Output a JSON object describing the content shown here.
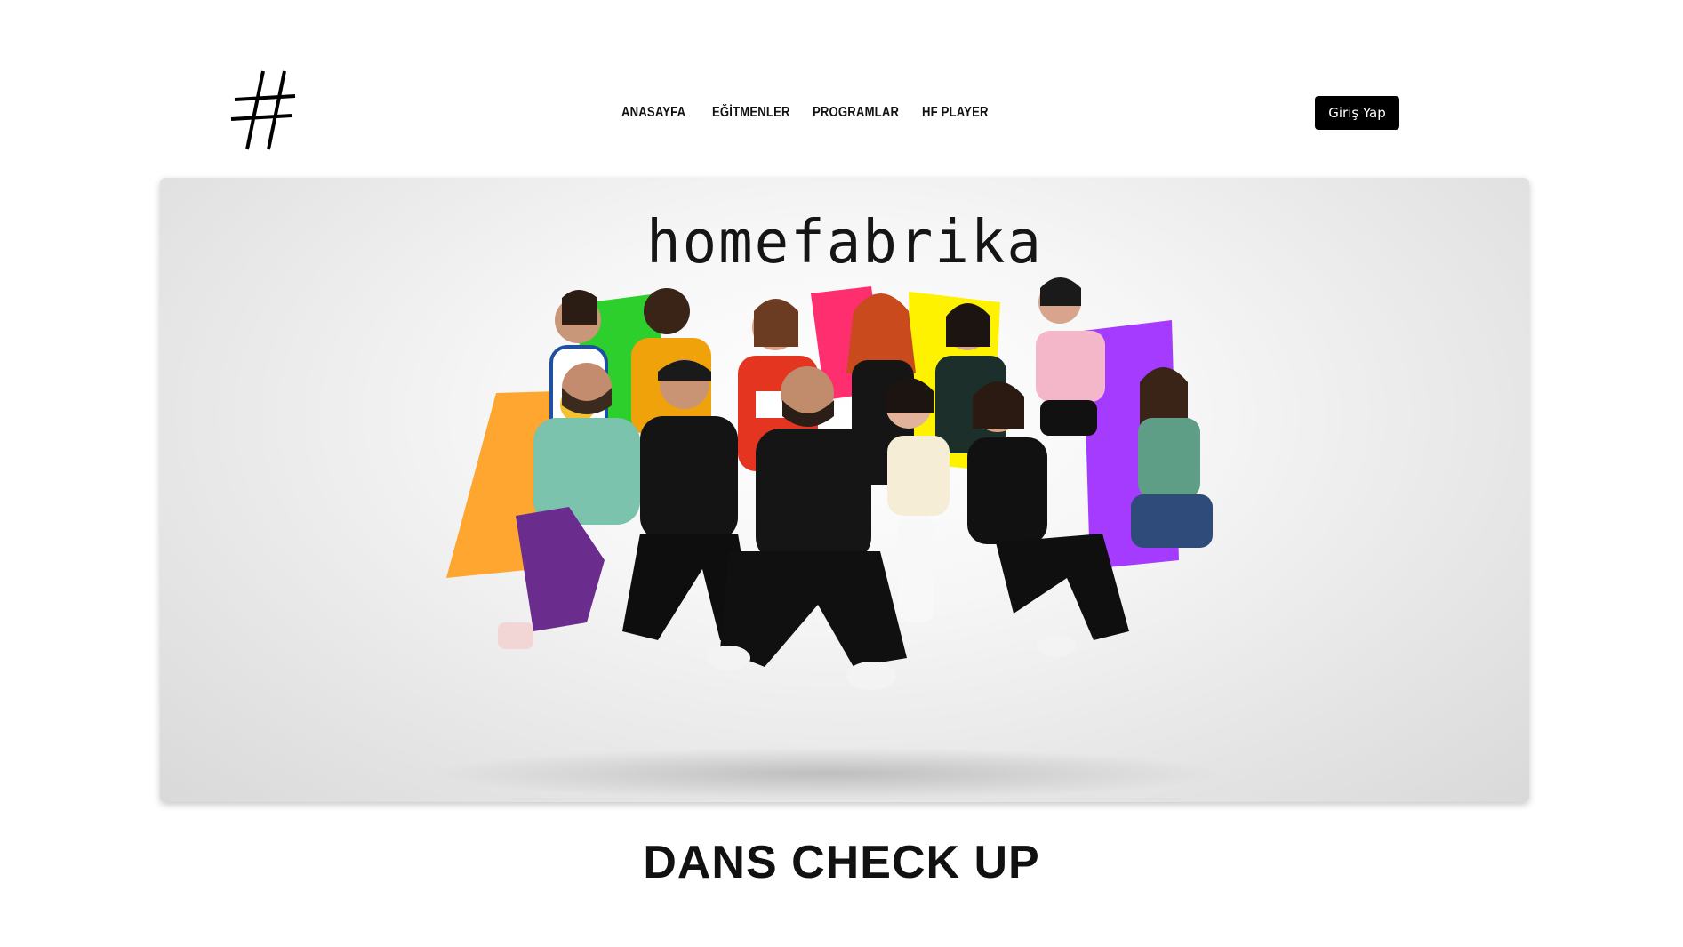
{
  "header": {
    "logo_icon": "hash-icon",
    "nav": [
      {
        "label": "ANASAYFA"
      },
      {
        "label": "EĞİTMENLER"
      },
      {
        "label": "PROGRAMLAR"
      },
      {
        "label": "HF PLAYER"
      }
    ],
    "login_label": "Giriş Yap"
  },
  "hero": {
    "wordmark": "homefabrika",
    "colors": {
      "orange": "#ffa630",
      "green": "#2ccf2c",
      "pink": "#ff2e6e",
      "yellow": "#fff200",
      "purple": "#a53bff"
    }
  },
  "section": {
    "title": "DANS CHECK UP"
  }
}
